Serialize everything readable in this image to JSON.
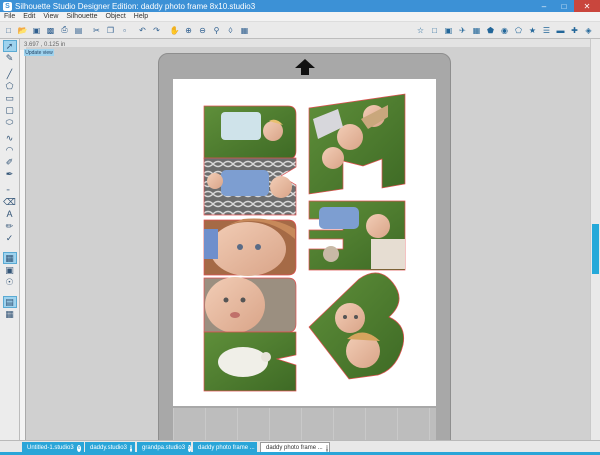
{
  "window": {
    "title": "Silhouette Studio Designer Edition: daddy photo frame 8x10.studio3",
    "min_label": "–",
    "max_label": "□",
    "close_label": "✕"
  },
  "menu": [
    "File",
    "Edit",
    "View",
    "Silhouette",
    "Object",
    "Help"
  ],
  "toolbar": {
    "icons": [
      "new-file-icon",
      "open-icon",
      "save-icon",
      "save-as-icon",
      "print-icon",
      "cut-send-icon",
      "cut-icon",
      "copy-icon",
      "paste-icon",
      "undo-icon",
      "redo-icon",
      "pan-icon",
      "zoom-in-icon",
      "zoom-out-icon",
      "zoom-box-icon",
      "zoom-fit-icon",
      "grid-icon"
    ],
    "right_icons": [
      "design-store-icon",
      "page-setup-icon",
      "registration-icon",
      "cut-settings-icon",
      "grid-settings-icon",
      "fill-icon",
      "line-icon",
      "shape-icon",
      "replicate-icon",
      "align-icon",
      "transform-icon",
      "offset-icon",
      "trace-icon"
    ]
  },
  "subbar": {
    "coords": "3.697 , 0.125 in"
  },
  "canvas": {
    "badge": "Update view"
  },
  "colors": {
    "accent": "#2aa5d8",
    "titlebar": "#3c91d6",
    "close": "#c9463d",
    "mat": "#a8a8a8",
    "cut_line": "#e05050"
  },
  "tabs": [
    {
      "label": "Untitled-1.studio3",
      "active": false
    },
    {
      "label": "daddy.studio3",
      "active": false
    },
    {
      "label": "grandpa.studio3",
      "active": false
    },
    {
      "label": "daddy photo frame ...",
      "active": false
    },
    {
      "label": "daddy photo frame ...",
      "active": true
    }
  ],
  "close_tab_glyph": "x"
}
